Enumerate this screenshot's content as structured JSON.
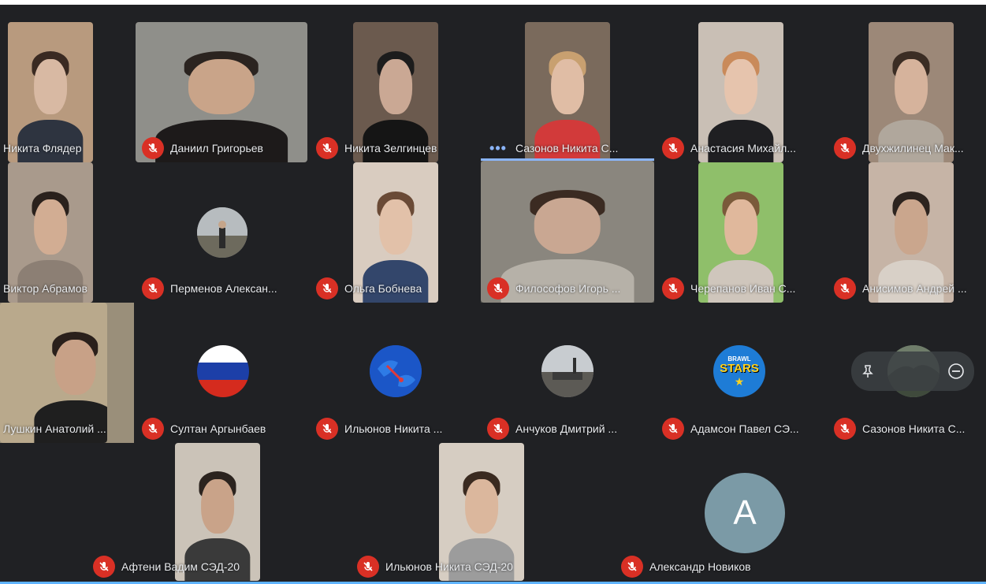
{
  "participants": [
    {
      "name": "Никита Флядер",
      "mic": "unmuted"
    },
    {
      "name": "Даниил Григорьев",
      "mic": "muted"
    },
    {
      "name": "Никита Зелгинцев",
      "mic": "muted"
    },
    {
      "name": "Сазонов Никита С...",
      "mic": "talking"
    },
    {
      "name": "Анастасия Михайл...",
      "mic": "muted"
    },
    {
      "name": "Двухжилинец Мак...",
      "mic": "muted"
    },
    {
      "name": "Виктор Абрамов",
      "mic": "unmuted"
    },
    {
      "name": "Перменов Алексан...",
      "mic": "muted"
    },
    {
      "name": "Ольга Бобнева",
      "mic": "muted"
    },
    {
      "name": "Философов Игорь ...",
      "mic": "muted"
    },
    {
      "name": "Черепанов Иван С...",
      "mic": "muted"
    },
    {
      "name": "Анисимов Андрей ...",
      "mic": "muted"
    },
    {
      "name": "Лушкин Анатолий ...",
      "mic": "unmuted"
    },
    {
      "name": "Султан Аргынбаев",
      "mic": "muted"
    },
    {
      "name": "Ильюнов Никита ...",
      "mic": "muted"
    },
    {
      "name": "Анчуков Дмитрий ...",
      "mic": "muted"
    },
    {
      "name": "Адамсон Павел СЭ...",
      "mic": "muted"
    },
    {
      "name": "Сазонов Никита С...",
      "mic": "muted"
    },
    {
      "name": "Афтени Вадим СЭД-20",
      "mic": "muted"
    },
    {
      "name": "Ильюнов Никита СЭД-20",
      "mic": "muted"
    },
    {
      "name": "Александр Новиков",
      "mic": "muted"
    }
  ],
  "avatars": {
    "stars_text_1": "BRAWL",
    "stars_text_2": "STARS",
    "letter": "A"
  },
  "colors": {
    "background": "#202124",
    "tile": "#3c4043",
    "muted_red": "#d93025",
    "talking_blue": "#8ab4f8"
  }
}
